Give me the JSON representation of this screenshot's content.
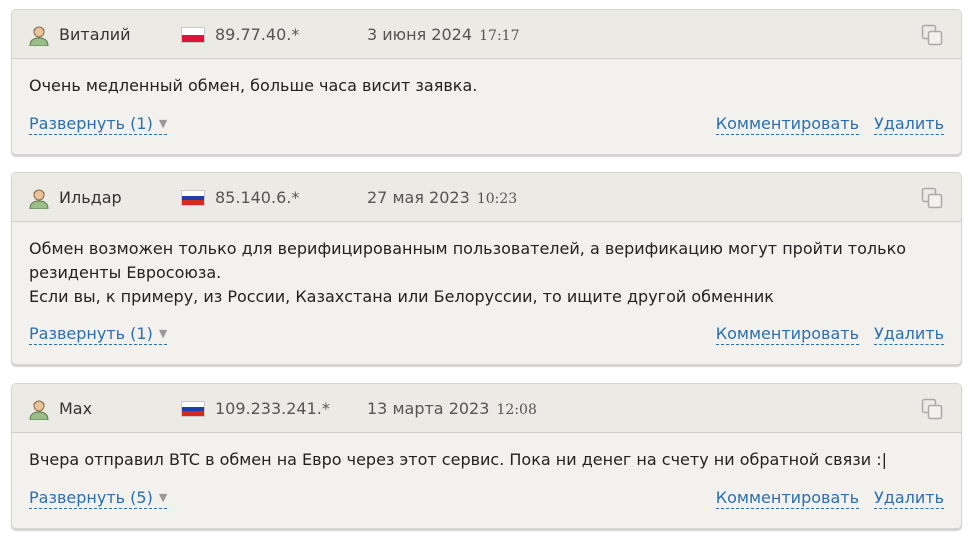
{
  "comments": [
    {
      "author": "Виталий",
      "flag": "pl",
      "ip": "89.77.40.*",
      "date": "3 июня 2024",
      "time": "17:17",
      "text": "Очень медленный обмен, больше часа висит заявка.",
      "expand_label": "Развернуть (1)",
      "comment_label": "Комментировать",
      "delete_label": "Удалить"
    },
    {
      "author": "Ильдар",
      "flag": "ru",
      "ip": "85.140.6.*",
      "date": "27 мая 2023",
      "time": "10:23",
      "text": "Обмен возможен только для верифицированным пользователей, а верификацию могут пройти только\nрезиденты Евросоюза.\nЕсли вы, к примеру, из России, Казахстана или Белоруссии, то ищите другой обменник",
      "expand_label": "Развернуть (1)",
      "comment_label": "Комментировать",
      "delete_label": "Удалить"
    },
    {
      "author": "Max",
      "flag": "ru",
      "ip": "109.233.241.*",
      "date": "13 марта 2023",
      "time": "12:08",
      "text": "Вчера отправил BTC в обмен на Евро через этот сервис. Пока ни денег на счету ни обратной связи :|",
      "expand_label": "Развернуть (5)",
      "comment_label": "Комментировать",
      "delete_label": "Удалить"
    }
  ],
  "icons": {
    "avatar": "user-avatar-icon",
    "copy": "copy-icon",
    "expand_arrow": "▼"
  },
  "colors": {
    "link": "#2a6fb0",
    "card_bg": "#f2f1ed",
    "header_bg": "#eceae5"
  }
}
